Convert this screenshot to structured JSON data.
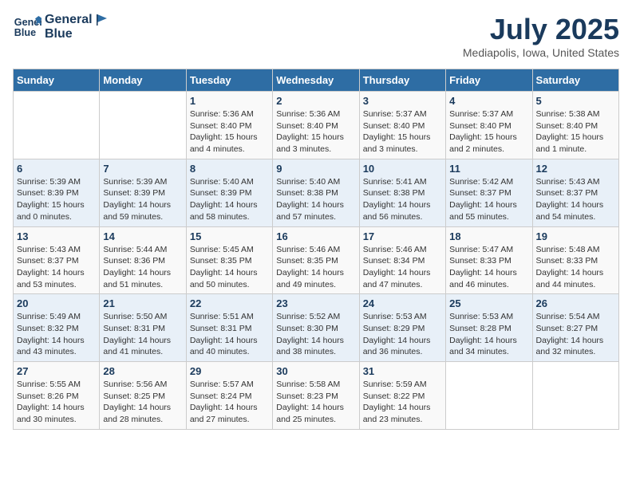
{
  "header": {
    "logo_line1": "General",
    "logo_line2": "Blue",
    "title": "July 2025",
    "subtitle": "Mediapolis, Iowa, United States"
  },
  "days_of_week": [
    "Sunday",
    "Monday",
    "Tuesday",
    "Wednesday",
    "Thursday",
    "Friday",
    "Saturday"
  ],
  "weeks": [
    [
      {
        "num": "",
        "info": ""
      },
      {
        "num": "",
        "info": ""
      },
      {
        "num": "1",
        "info": "Sunrise: 5:36 AM\nSunset: 8:40 PM\nDaylight: 15 hours and 4 minutes."
      },
      {
        "num": "2",
        "info": "Sunrise: 5:36 AM\nSunset: 8:40 PM\nDaylight: 15 hours and 3 minutes."
      },
      {
        "num": "3",
        "info": "Sunrise: 5:37 AM\nSunset: 8:40 PM\nDaylight: 15 hours and 3 minutes."
      },
      {
        "num": "4",
        "info": "Sunrise: 5:37 AM\nSunset: 8:40 PM\nDaylight: 15 hours and 2 minutes."
      },
      {
        "num": "5",
        "info": "Sunrise: 5:38 AM\nSunset: 8:40 PM\nDaylight: 15 hours and 1 minute."
      }
    ],
    [
      {
        "num": "6",
        "info": "Sunrise: 5:39 AM\nSunset: 8:39 PM\nDaylight: 15 hours and 0 minutes."
      },
      {
        "num": "7",
        "info": "Sunrise: 5:39 AM\nSunset: 8:39 PM\nDaylight: 14 hours and 59 minutes."
      },
      {
        "num": "8",
        "info": "Sunrise: 5:40 AM\nSunset: 8:39 PM\nDaylight: 14 hours and 58 minutes."
      },
      {
        "num": "9",
        "info": "Sunrise: 5:40 AM\nSunset: 8:38 PM\nDaylight: 14 hours and 57 minutes."
      },
      {
        "num": "10",
        "info": "Sunrise: 5:41 AM\nSunset: 8:38 PM\nDaylight: 14 hours and 56 minutes."
      },
      {
        "num": "11",
        "info": "Sunrise: 5:42 AM\nSunset: 8:37 PM\nDaylight: 14 hours and 55 minutes."
      },
      {
        "num": "12",
        "info": "Sunrise: 5:43 AM\nSunset: 8:37 PM\nDaylight: 14 hours and 54 minutes."
      }
    ],
    [
      {
        "num": "13",
        "info": "Sunrise: 5:43 AM\nSunset: 8:37 PM\nDaylight: 14 hours and 53 minutes."
      },
      {
        "num": "14",
        "info": "Sunrise: 5:44 AM\nSunset: 8:36 PM\nDaylight: 14 hours and 51 minutes."
      },
      {
        "num": "15",
        "info": "Sunrise: 5:45 AM\nSunset: 8:35 PM\nDaylight: 14 hours and 50 minutes."
      },
      {
        "num": "16",
        "info": "Sunrise: 5:46 AM\nSunset: 8:35 PM\nDaylight: 14 hours and 49 minutes."
      },
      {
        "num": "17",
        "info": "Sunrise: 5:46 AM\nSunset: 8:34 PM\nDaylight: 14 hours and 47 minutes."
      },
      {
        "num": "18",
        "info": "Sunrise: 5:47 AM\nSunset: 8:33 PM\nDaylight: 14 hours and 46 minutes."
      },
      {
        "num": "19",
        "info": "Sunrise: 5:48 AM\nSunset: 8:33 PM\nDaylight: 14 hours and 44 minutes."
      }
    ],
    [
      {
        "num": "20",
        "info": "Sunrise: 5:49 AM\nSunset: 8:32 PM\nDaylight: 14 hours and 43 minutes."
      },
      {
        "num": "21",
        "info": "Sunrise: 5:50 AM\nSunset: 8:31 PM\nDaylight: 14 hours and 41 minutes."
      },
      {
        "num": "22",
        "info": "Sunrise: 5:51 AM\nSunset: 8:31 PM\nDaylight: 14 hours and 40 minutes."
      },
      {
        "num": "23",
        "info": "Sunrise: 5:52 AM\nSunset: 8:30 PM\nDaylight: 14 hours and 38 minutes."
      },
      {
        "num": "24",
        "info": "Sunrise: 5:53 AM\nSunset: 8:29 PM\nDaylight: 14 hours and 36 minutes."
      },
      {
        "num": "25",
        "info": "Sunrise: 5:53 AM\nSunset: 8:28 PM\nDaylight: 14 hours and 34 minutes."
      },
      {
        "num": "26",
        "info": "Sunrise: 5:54 AM\nSunset: 8:27 PM\nDaylight: 14 hours and 32 minutes."
      }
    ],
    [
      {
        "num": "27",
        "info": "Sunrise: 5:55 AM\nSunset: 8:26 PM\nDaylight: 14 hours and 30 minutes."
      },
      {
        "num": "28",
        "info": "Sunrise: 5:56 AM\nSunset: 8:25 PM\nDaylight: 14 hours and 28 minutes."
      },
      {
        "num": "29",
        "info": "Sunrise: 5:57 AM\nSunset: 8:24 PM\nDaylight: 14 hours and 27 minutes."
      },
      {
        "num": "30",
        "info": "Sunrise: 5:58 AM\nSunset: 8:23 PM\nDaylight: 14 hours and 25 minutes."
      },
      {
        "num": "31",
        "info": "Sunrise: 5:59 AM\nSunset: 8:22 PM\nDaylight: 14 hours and 23 minutes."
      },
      {
        "num": "",
        "info": ""
      },
      {
        "num": "",
        "info": ""
      }
    ]
  ]
}
